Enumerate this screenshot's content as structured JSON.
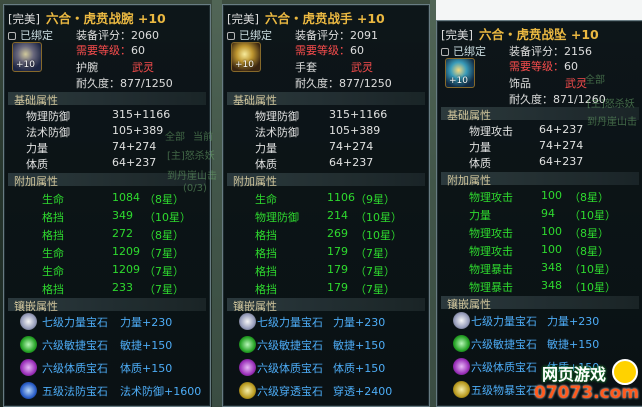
{
  "overlay_fragments": {
    "a": "全部",
    "b": "当前",
    "c": "[主]怒杀妖",
    "d": "到丹崖山击",
    "e": "(0/3)"
  },
  "logo": {
    "line1": "网页游戏",
    "line2": "07073.com"
  },
  "panels": [
    {
      "quality": "[完美]",
      "name": "六合・虎贲战腕",
      "plus": "+10",
      "bound": "已绑定",
      "score_label": "装备评分：",
      "score": "2060",
      "level_label": "需要等级：",
      "level": "60",
      "type": "护腕",
      "class": "武灵",
      "dur_label": "耐久度：",
      "dur": "877/1250",
      "icon_plus": "+10",
      "base_title": "基础属性",
      "base": [
        {
          "k": "物理防御",
          "v": "315+1166"
        },
        {
          "k": "法术防御",
          "v": "105+389"
        },
        {
          "k": "力量",
          "v": "74+274"
        },
        {
          "k": "体质",
          "v": "64+237"
        }
      ],
      "extra_title": "附加属性",
      "extra": [
        {
          "k": "生命",
          "v": "1084",
          "s": "（8星）"
        },
        {
          "k": "格挡",
          "v": "349",
          "s": "（10星）"
        },
        {
          "k": "格挡",
          "v": "272",
          "s": "（8星）"
        },
        {
          "k": "生命",
          "v": "1209",
          "s": "（7星）"
        },
        {
          "k": "生命",
          "v": "1209",
          "s": "（7星）"
        },
        {
          "k": "格挡",
          "v": "233",
          "s": "（7星）"
        }
      ],
      "gem_title": "镶嵌属性",
      "gems": [
        {
          "n": "七级力量宝石",
          "e": "力量+230",
          "c": "#c8c8d8"
        },
        {
          "n": "六级敏捷宝石",
          "e": "敏捷+150",
          "c": "#39c139"
        },
        {
          "n": "六级体质宝石",
          "e": "体质+150",
          "c": "#b040c8"
        },
        {
          "n": "五级法防宝石",
          "e": "法术防御+1600",
          "c": "#3a78e6"
        }
      ]
    },
    {
      "quality": "[完美]",
      "name": "六合・虎贲战手",
      "plus": "+10",
      "bound": "已绑定",
      "score_label": "装备评分：",
      "score": "2091",
      "level_label": "需要等级：",
      "level": "60",
      "type": "手套",
      "class": "武灵",
      "dur_label": "耐久度：",
      "dur": "877/1250",
      "icon_plus": "+10",
      "base_title": "基础属性",
      "base": [
        {
          "k": "物理防御",
          "v": "315+1166"
        },
        {
          "k": "法术防御",
          "v": "105+389"
        },
        {
          "k": "力量",
          "v": "74+274"
        },
        {
          "k": "体质",
          "v": "64+237"
        }
      ],
      "extra_title": "附加属性",
      "extra": [
        {
          "k": "生命",
          "v": "1106",
          "s": "（9星）"
        },
        {
          "k": "物理防御",
          "v": "214",
          "s": "（10星）"
        },
        {
          "k": "格挡",
          "v": "269",
          "s": "（10星）"
        },
        {
          "k": "格挡",
          "v": "179",
          "s": "（7星）"
        },
        {
          "k": "格挡",
          "v": "179",
          "s": "（7星）"
        },
        {
          "k": "格挡",
          "v": "179",
          "s": "（7星）"
        }
      ],
      "gem_title": "镶嵌属性",
      "gems": [
        {
          "n": "七级力量宝石",
          "e": "力量+230",
          "c": "#c8c8d8"
        },
        {
          "n": "六级敏捷宝石",
          "e": "敏捷+150",
          "c": "#39c139"
        },
        {
          "n": "六级体质宝石",
          "e": "体质+150",
          "c": "#b040c8"
        },
        {
          "n": "六级穿透宝石",
          "e": "穿透+2400",
          "c": "#e0c040"
        }
      ]
    },
    {
      "quality": "[完美]",
      "name": "六合・虎贲战坠",
      "plus": "+10",
      "bound": "已绑定",
      "score_label": "装备评分：",
      "score": "2156",
      "level_label": "需要等级：",
      "level": "60",
      "type": "饰品",
      "class": "武灵",
      "dur_label": "耐久度：",
      "dur": "871/1260",
      "icon_plus": "+10",
      "base_title": "基础属性",
      "base": [
        {
          "k": "物理攻击",
          "v": "64+237"
        },
        {
          "k": "力量",
          "v": "74+274"
        },
        {
          "k": "体质",
          "v": "64+237"
        }
      ],
      "extra_title": "附加属性",
      "extra": [
        {
          "k": "物理攻击",
          "v": "100",
          "s": "（8星）"
        },
        {
          "k": "力量",
          "v": "94",
          "s": "（10星）"
        },
        {
          "k": "物理攻击",
          "v": "100",
          "s": "（8星）"
        },
        {
          "k": "物理攻击",
          "v": "100",
          "s": "（8星）"
        },
        {
          "k": "物理暴击",
          "v": "348",
          "s": "（10星）"
        },
        {
          "k": "物理暴击",
          "v": "348",
          "s": "（10星）"
        }
      ],
      "gem_title": "镶嵌属性",
      "gems": [
        {
          "n": "七级力量宝石",
          "e": "力量+230",
          "c": "#c8c8d8"
        },
        {
          "n": "六级敏捷宝石",
          "e": "敏捷+150",
          "c": "#39c139"
        },
        {
          "n": "六级体质宝石",
          "e": "体质+150",
          "c": "#b040c8"
        },
        {
          "n": "五级物暴宝石",
          "e": "",
          "c": "#e0c040"
        }
      ]
    }
  ]
}
